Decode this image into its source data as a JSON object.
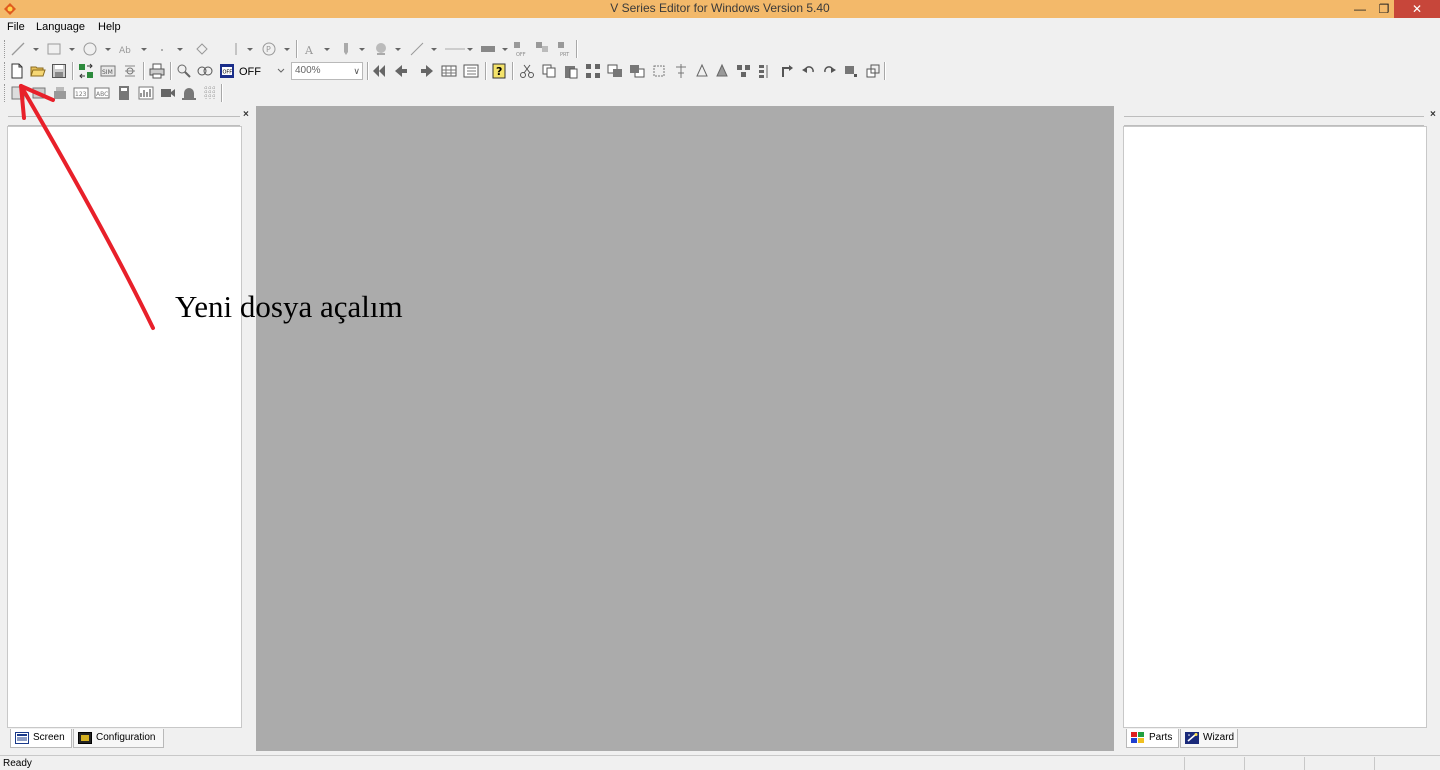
{
  "window": {
    "title": "V Series Editor for Windows Version 5.40",
    "minimize_glyph": "—",
    "restore_glyph": "❐",
    "close_glyph": "✕"
  },
  "menu": {
    "items": [
      "File",
      "Language",
      "Help"
    ]
  },
  "toolbar": {
    "switch_state": "OFF",
    "zoom_value": "400%"
  },
  "left_panel": {
    "close_glyph": "×",
    "tabs": [
      "Screen",
      "Configuration"
    ]
  },
  "right_panel": {
    "close_glyph": "×",
    "tabs": [
      "Parts",
      "Wizard"
    ]
  },
  "status": {
    "text": "Ready"
  },
  "annotation": {
    "text": "Yeni dosya açalım",
    "color": "#e8202a"
  },
  "colors": {
    "titlebar": "#f3b96a",
    "workspace": "#ababab",
    "close_button": "#c7463a"
  }
}
